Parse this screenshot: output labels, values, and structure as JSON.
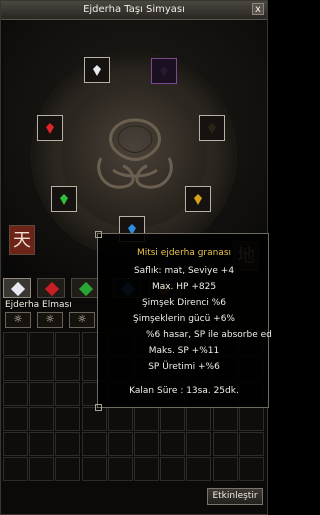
{
  "window": {
    "title": "Ejderha Taşı Simyası",
    "close_label": "x"
  },
  "side_badges": {
    "left": "天",
    "right": "地"
  },
  "grade": {
    "label": "Ejderha Elması",
    "button_glyph": "☼"
  },
  "activate_label": "Etkinleştir",
  "tooltip": {
    "name": "Mitsi ejderha granası",
    "purity": "Saflık: mat, Seviye +4",
    "max_hp": "Max. HP +825",
    "lightning_res": "Şimşek Direnci %6",
    "lightning_power": "Şimşeklerin gücü +6%",
    "absorb": "%6 hasar, SP ile absorbe ed",
    "max_sp": "Maks. SP +%11",
    "sp_regen": "SP Üretimi +%6",
    "remaining": "Kalan Süre : 13sa. 25dk."
  },
  "colors": {
    "gem_white": "#e8e8f0",
    "gem_purple": "#9b5fc0",
    "gem_red": "#e0242a",
    "gem_green": "#2fbf3a",
    "gem_blue": "#2f8de0",
    "gem_gold": "#d9a11b",
    "tooltip_name": "#e8c44a"
  },
  "slots": [
    {
      "name": "slot-diamond-top",
      "gem": "gem_white"
    },
    {
      "name": "slot-top-right",
      "gem": "gem_purple"
    },
    {
      "name": "slot-ruby-left",
      "gem": "gem_red"
    },
    {
      "name": "slot-right-gold",
      "gem": "gem_gold"
    },
    {
      "name": "slot-jade-left",
      "gem": "gem_green"
    },
    {
      "name": "slot-garnet-right",
      "gem": "gem_gold"
    },
    {
      "name": "slot-sapphire-bottom",
      "gem": "gem_blue"
    }
  ],
  "tabs": [
    {
      "name": "tab-diamond",
      "gem": "gem_white"
    },
    {
      "name": "tab-ruby",
      "gem": "gem_red"
    },
    {
      "name": "tab-jade",
      "gem": "gem_green"
    },
    {
      "name": "tab-sapphire",
      "gem": "gem_blue"
    },
    {
      "name": "tab-garnet",
      "gem": "gem_gold"
    }
  ]
}
